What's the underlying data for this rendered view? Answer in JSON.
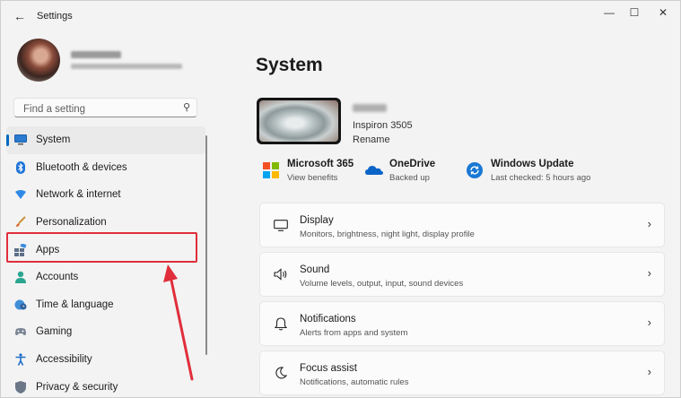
{
  "window": {
    "title": "Settings",
    "back_glyph": "←",
    "min_glyph": "—",
    "max_glyph": "☐",
    "close_glyph": "✕"
  },
  "search": {
    "placeholder": "Find a setting",
    "icon_glyph": "⚲"
  },
  "sidebar": {
    "items": [
      {
        "label": "System",
        "icon": "system-icon",
        "selected": true
      },
      {
        "label": "Bluetooth & devices",
        "icon": "bluetooth-icon"
      },
      {
        "label": "Network & internet",
        "icon": "wifi-icon"
      },
      {
        "label": "Personalization",
        "icon": "brush-icon"
      },
      {
        "label": "Apps",
        "icon": "apps-icon",
        "highlighted": true
      },
      {
        "label": "Accounts",
        "icon": "person-icon"
      },
      {
        "label": "Time & language",
        "icon": "globe-clock-icon"
      },
      {
        "label": "Gaming",
        "icon": "gamepad-icon"
      },
      {
        "label": "Accessibility",
        "icon": "accessibility-icon"
      },
      {
        "label": "Privacy & security",
        "icon": "shield-icon"
      }
    ]
  },
  "main": {
    "title": "System",
    "device": {
      "model": "Inspiron 3505",
      "rename": "Rename"
    },
    "quick_links": [
      {
        "title": "Microsoft 365",
        "subtitle": "View benefits",
        "icon": "microsoft-365-icon"
      },
      {
        "title": "OneDrive",
        "subtitle": "Backed up",
        "icon": "onedrive-icon"
      },
      {
        "title": "Windows Update",
        "subtitle": "Last checked: 5 hours ago",
        "icon": "windows-update-icon"
      }
    ],
    "cards": [
      {
        "title": "Display",
        "subtitle": "Monitors, brightness, night light, display profile",
        "icon": "monitor-icon"
      },
      {
        "title": "Sound",
        "subtitle": "Volume levels, output, input, sound devices",
        "icon": "speaker-icon"
      },
      {
        "title": "Notifications",
        "subtitle": "Alerts from apps and system",
        "icon": "bell-icon"
      },
      {
        "title": "Focus assist",
        "subtitle": "Notifications, automatic rules",
        "icon": "moon-icon"
      }
    ],
    "chevron": "›"
  },
  "colors": {
    "accent": "#0067c0",
    "annotation": "#e02e3a",
    "background": "#f3f3f3"
  }
}
